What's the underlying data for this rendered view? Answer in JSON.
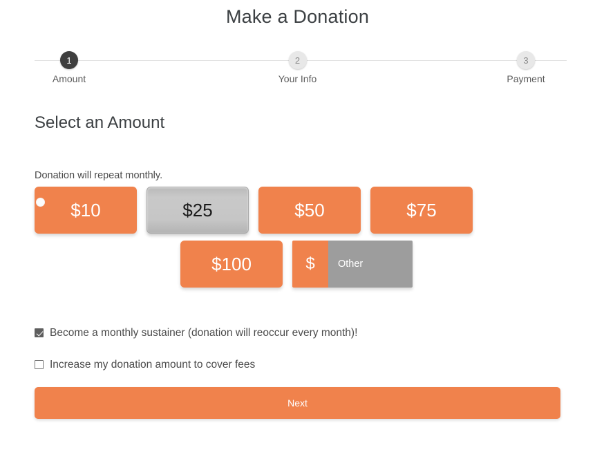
{
  "header": {
    "title": "Make a Donation"
  },
  "stepper": {
    "steps": [
      {
        "number": "1",
        "label": "Amount",
        "state": "active"
      },
      {
        "number": "2",
        "label": "Your Info",
        "state": "inactive"
      },
      {
        "number": "3",
        "label": "Payment",
        "state": "inactive"
      }
    ]
  },
  "amount_section": {
    "heading": "Select an Amount",
    "repeat_note": "Donation will repeat monthly.",
    "presets": [
      {
        "label": "$10",
        "value": 10,
        "selected": false
      },
      {
        "label": "$25",
        "value": 25,
        "selected": true
      },
      {
        "label": "$50",
        "value": 50,
        "selected": false
      },
      {
        "label": "$75",
        "value": 75,
        "selected": false
      },
      {
        "label": "$100",
        "value": 100,
        "selected": false
      }
    ],
    "other": {
      "currency_prefix": "$",
      "placeholder": "Other",
      "value": ""
    }
  },
  "options": [
    {
      "label": "Become a monthly sustainer (donation will reoccur every month)!",
      "checked": true
    },
    {
      "label": "Increase my donation amount to cover fees",
      "checked": false
    }
  ],
  "footer": {
    "next_label": "Next"
  },
  "colors": {
    "accent": "#f0824c",
    "selected_gray": "#c4c4c4",
    "input_gray": "#9d9d9d",
    "active_step": "#3f3f3f",
    "text": "#4a4a4a"
  }
}
